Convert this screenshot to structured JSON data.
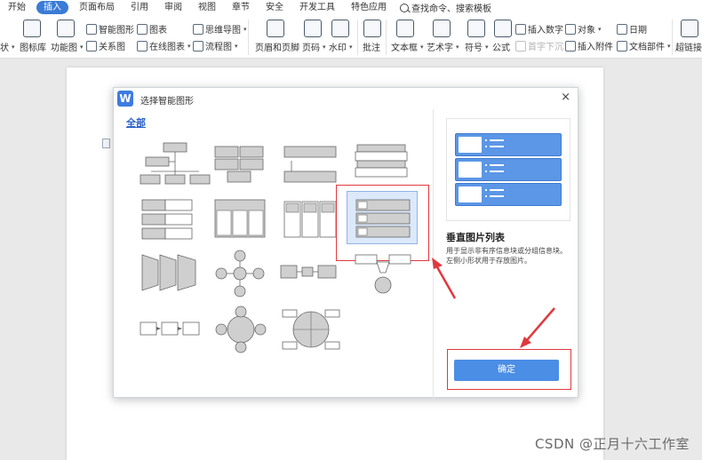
{
  "menu": {
    "tabs": [
      {
        "label": "开始",
        "active": false
      },
      {
        "label": "插入",
        "active": true
      },
      {
        "label": "页面布局",
        "active": false
      },
      {
        "label": "引用",
        "active": false
      },
      {
        "label": "审阅",
        "active": false
      },
      {
        "label": "视图",
        "active": false
      },
      {
        "label": "章节",
        "active": false
      },
      {
        "label": "安全",
        "active": false
      },
      {
        "label": "开发工具",
        "active": false
      },
      {
        "label": "特色应用",
        "active": false
      }
    ],
    "search_label": "查找命令、搜索模板"
  },
  "ribbon": {
    "shapes": "状",
    "icon_lib": "图标库",
    "func_chart": "功能图",
    "smart_art": "智能图形",
    "chart": "图表",
    "relation": "关系图",
    "online_chart": "在线图表",
    "mind_map": "思维导图",
    "flowchart": "流程图",
    "header_footer": "页眉和页脚",
    "page_number": "页码",
    "watermark": "水印",
    "comment": "批注",
    "textbox": "文本框",
    "wordart": "艺术字",
    "symbol": "符号",
    "formula": "公式",
    "insert_number": "插入数字",
    "object": "对象",
    "dropcap": "首字下沉",
    "insert_attachment": "插入附件",
    "date": "日期",
    "doc_parts": "文档部件",
    "hyperlink": "超链接"
  },
  "dialog": {
    "title": "选择智能图形",
    "close_symbol": "×",
    "category": "全部",
    "preview": {
      "name": "垂直图片列表",
      "description": "用于显示非有序信息块或分组信息块。左侧小形状用于存放图片。"
    },
    "ok_label": "确定"
  },
  "footer": {
    "watermark": "CSDN @正月十六工作室"
  },
  "colors": {
    "accent": "#3a7bd5",
    "preview_fill": "#5b97e6",
    "highlight_red": "#e0393e",
    "template_gray": "#cfcfcf"
  }
}
